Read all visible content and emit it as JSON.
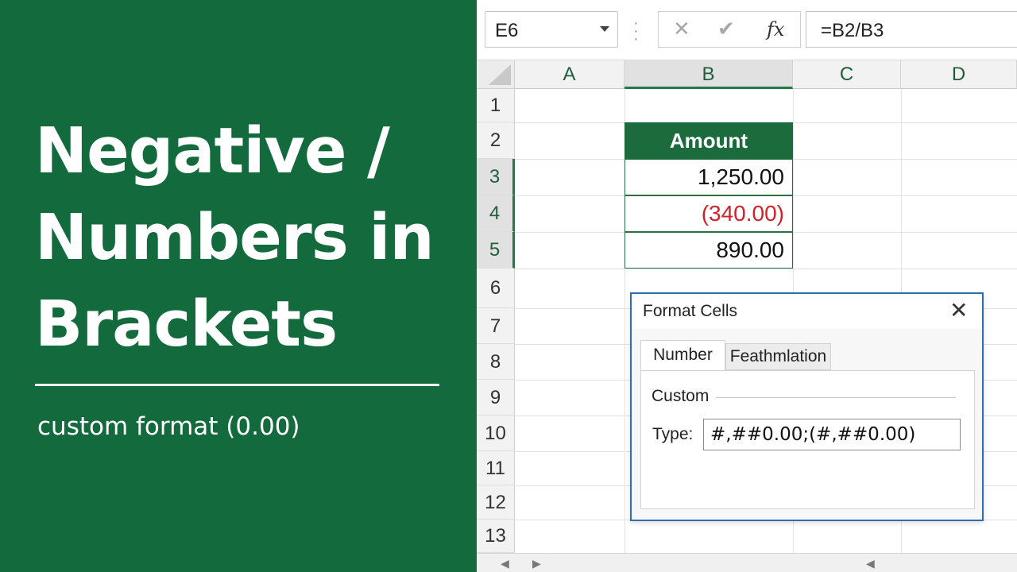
{
  "panel": {
    "title_lines": [
      "Negative /",
      "Numbers in",
      "Brackets"
    ],
    "subtitle": "custom format (0.00)",
    "bg_color": "#136a3d"
  },
  "formula_bar": {
    "name_box": "E6",
    "cancel_icon": "✕",
    "enter_icon": "✔",
    "fx_icon": "fx",
    "formula": "=B2/B3"
  },
  "columns": [
    "A",
    "B",
    "C",
    "D"
  ],
  "rows": [
    "1",
    "2",
    "3",
    "4",
    "5",
    "6",
    "7",
    "8",
    "9",
    "10",
    "11",
    "12",
    "13"
  ],
  "active_column": "B",
  "active_rows": [
    "3",
    "4",
    "5"
  ],
  "table": {
    "header": "Amount",
    "values": [
      "1,250.00",
      "(340.00)",
      "890.00"
    ],
    "negative_color": "#d1222b",
    "header_color": "#1b6b3d"
  },
  "dialog": {
    "title": "Format Cells",
    "close": "✕",
    "tabs": [
      "Number",
      "Feathmlation"
    ],
    "category": "Custom",
    "type_label": "Type:",
    "type_value": "#,##0.00;(#,##0.00)"
  }
}
